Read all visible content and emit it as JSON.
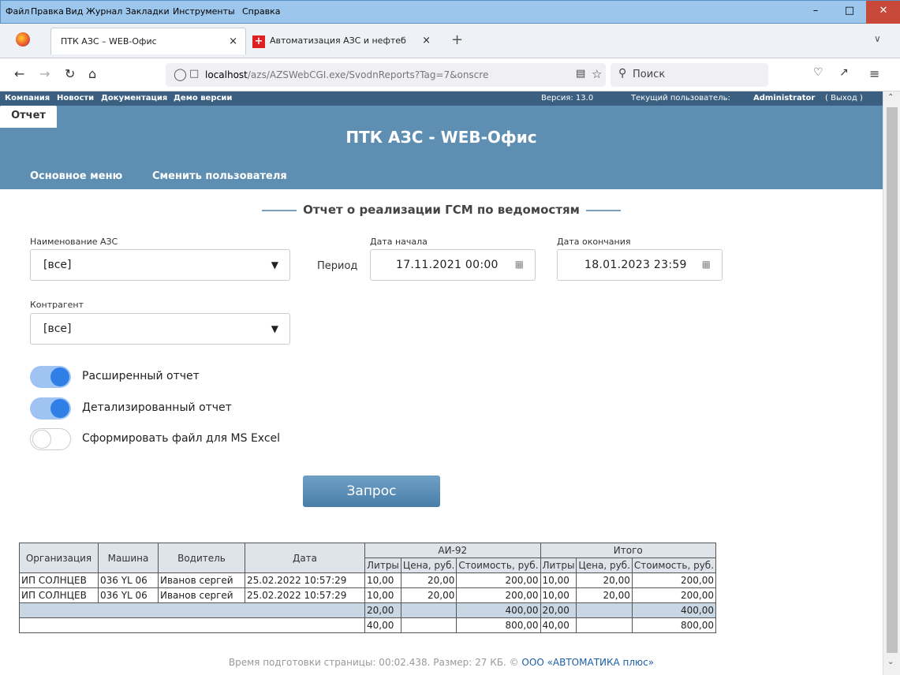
{
  "browser": {
    "menu": [
      "Файл",
      "Правка",
      "Вид",
      "Журнал",
      "Закладки",
      "Инструменты",
      "Справка"
    ],
    "tabs": [
      {
        "title": "ПТК АЗС – WEB-Офис",
        "close": "×"
      },
      {
        "title": "Автоматизация АЗС и нефтеб",
        "close": "×"
      }
    ],
    "new_tab": "+",
    "url": "localhost/azs/AZSWebCGI.exe/SvodnReports?Tag=7&onscre",
    "url_host": "localhost",
    "url_path": "/azs/AZSWebCGI.exe/SvodnReports?Tag=7&onscre",
    "search_placeholder": "Поиск"
  },
  "topstrip": {
    "links": [
      "Компания",
      "Новости",
      "Документация",
      "Демо версии"
    ],
    "version": "Версия: 13.0",
    "user_prefix": "Текущий пользователь:",
    "user": "Administrator",
    "logout": "( Выход )"
  },
  "header": {
    "title": "ПТК АЗС - WEB-Офис",
    "tabs": [
      "Основное меню",
      "Сменить пользователя",
      "Отчет"
    ]
  },
  "form": {
    "title": "Отчет о реализации ГСМ по ведомостям",
    "station_label": "Наименование АЗС",
    "station_value": "[все]",
    "period_label": "Период",
    "start_label": "Дата начала",
    "start_value": "17.11.2021  00:00",
    "end_label": "Дата окончания",
    "end_value": "18.01.2023  23:59",
    "contractor_label": "Контрагент",
    "contractor_value": "[все]",
    "toggles": [
      {
        "label": "Расширенный отчет",
        "on": true
      },
      {
        "label": "Детализированный отчет",
        "on": true
      },
      {
        "label": "Сформировать файл для MS Excel",
        "on": false
      }
    ],
    "submit": "Запрос"
  },
  "table": {
    "headers": [
      "Организация",
      "Машина",
      "Водитель",
      "Дата"
    ],
    "groups": [
      "АИ-92",
      "Итого"
    ],
    "subheaders": [
      "Литры",
      "Цена, руб.",
      "Стоимость, руб.",
      "Литры",
      "Цена, руб.",
      "Стоимость, руб."
    ],
    "rows": [
      [
        "ИП СОЛНЦЕВ",
        "036 YL 06",
        "Иванов сергей",
        "25.02.2022 10:57:29",
        "10,00",
        "20,00",
        "200,00",
        "10,00",
        "20,00",
        "200,00"
      ],
      [
        "ИП СОЛНЦЕВ",
        "036 YL 06",
        "Иванов сергей",
        "25.02.2022 10:57:29",
        "10,00",
        "20,00",
        "200,00",
        "10,00",
        "20,00",
        "200,00"
      ]
    ],
    "subtotal": [
      "20,00",
      "",
      "400,00",
      "20,00",
      "",
      "400,00"
    ],
    "total": [
      "40,00",
      "",
      "800,00",
      "40,00",
      "",
      "800,00"
    ]
  },
  "footer": {
    "text": "Время подготовки страницы: 00:02.438. Размер: 27 КБ. ©",
    "link": "ООО «АВТОМАТИКА плюс»"
  }
}
